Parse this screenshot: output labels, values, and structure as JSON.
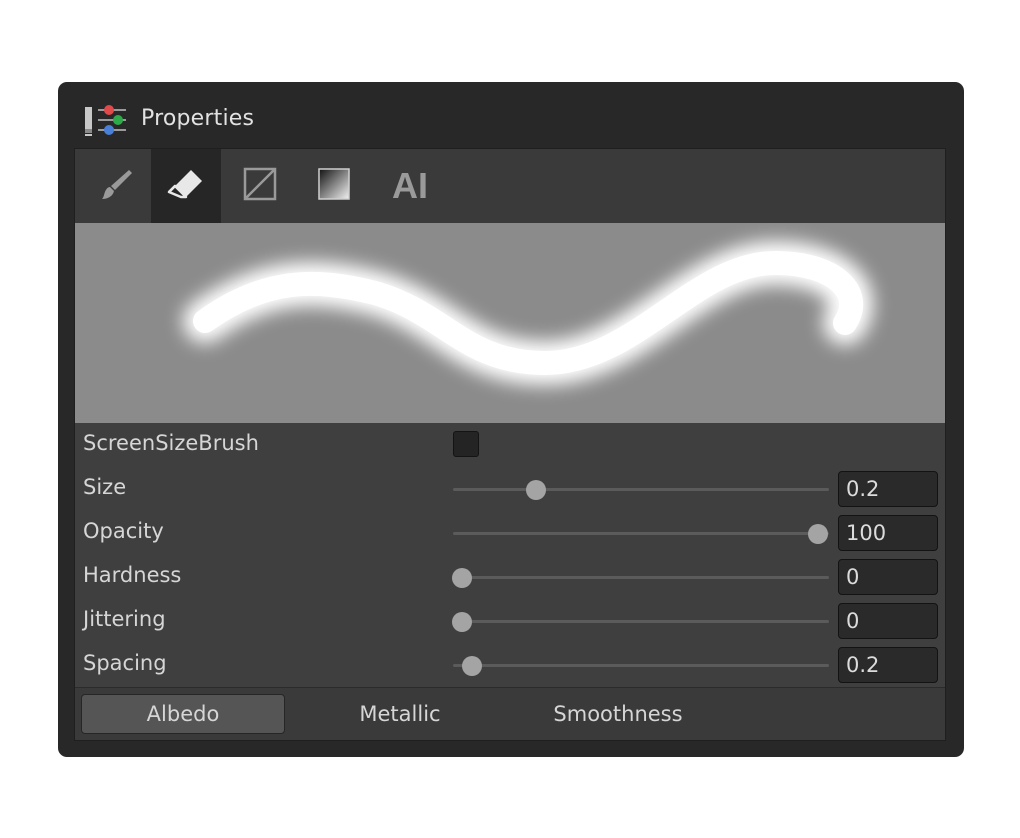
{
  "window": {
    "title": "Properties",
    "title_icon": "properties-sliders-icon"
  },
  "toolbar": {
    "tools": [
      {
        "icon": "brush-icon",
        "selected": false
      },
      {
        "icon": "eraser-icon",
        "selected": true
      },
      {
        "icon": "no-fill-icon",
        "selected": false
      },
      {
        "icon": "gradient-icon",
        "selected": false
      },
      {
        "label": "AI",
        "selected": false
      }
    ]
  },
  "brush_preview": {
    "icon": "brush-stroke-preview",
    "background": "#8b8b8b",
    "stroke_color": "#ffffff"
  },
  "properties": {
    "screen_size_brush": {
      "label": "ScreenSizeBrush",
      "checked": false
    },
    "size": {
      "label": "Size",
      "value": "0.2",
      "slider_fraction": 0.22
    },
    "opacity": {
      "label": "Opacity",
      "value": "100",
      "slider_fraction": 0.97
    },
    "hardness": {
      "label": "Hardness",
      "value": "0",
      "slider_fraction": 0.025
    },
    "jittering": {
      "label": "Jittering",
      "value": "0",
      "slider_fraction": 0.025
    },
    "spacing": {
      "label": "Spacing",
      "value": "0.2",
      "slider_fraction": 0.05
    }
  },
  "channel_tabs": [
    {
      "label": "Albedo",
      "selected": true
    },
    {
      "label": "Metallic",
      "selected": false
    },
    {
      "label": "Smoothness",
      "selected": false
    }
  ],
  "colors": {
    "window_bg": "#282828",
    "panel_bg": "#3f3f3f",
    "active_tool_bg": "#262626",
    "slider_thumb": "#a4a4a4",
    "icon_red": "#e04a4a",
    "icon_green": "#2faa4a",
    "icon_blue": "#4a7fd8"
  }
}
